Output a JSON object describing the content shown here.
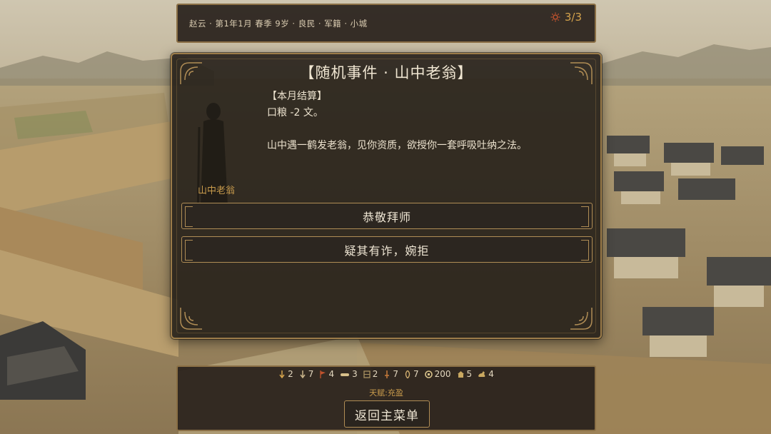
{
  "top_bar": {
    "status": "赵云 · 第1年1月 春季 9岁 · 良民 · 军籍 · 小城",
    "counter": "3/3",
    "counter_icon": "sun-icon"
  },
  "dialog": {
    "title": "【随机事件 · 山中老翁】",
    "settlement_header": "【本月结算】",
    "settlement_line": "口粮 -2 文。",
    "narrative": "山中遇一鹤发老翁，见你资质，欲授你一套呼吸吐纳之法。",
    "speaker": "山中老翁",
    "choices": [
      {
        "label": "恭敬拜师"
      },
      {
        "label": "疑其有诈，婉拒"
      }
    ]
  },
  "resources": [
    {
      "icon": "down-arrow-icon",
      "value": "2",
      "color": "#d4a34c"
    },
    {
      "icon": "down-arrow-icon",
      "value": "7",
      "color": "#c9b48a"
    },
    {
      "icon": "flag-icon",
      "value": "4",
      "color": "#c0522d"
    },
    {
      "icon": "rations-icon",
      "value": "3",
      "color": "#d8c08a"
    },
    {
      "icon": "book-icon",
      "value": "2",
      "color": "#a89060"
    },
    {
      "icon": "sword-icon",
      "value": "7",
      "color": "#c87a3a"
    },
    {
      "icon": "leaf-icon",
      "value": "7",
      "color": "#d4b070"
    },
    {
      "icon": "coin-icon",
      "value": "200",
      "color": "#d8c28a"
    },
    {
      "icon": "house-icon",
      "value": "5",
      "color": "#c9a860"
    },
    {
      "icon": "horse-icon",
      "value": "4",
      "color": "#c9a860"
    }
  ],
  "talent": "天赋:充盈",
  "menu_button": "返回主菜单",
  "colors": {
    "accent_gold": "#b08d55",
    "panel_bg": "#26201a",
    "text_light": "#ece2ce",
    "speaker_gold": "#c89b4c"
  }
}
